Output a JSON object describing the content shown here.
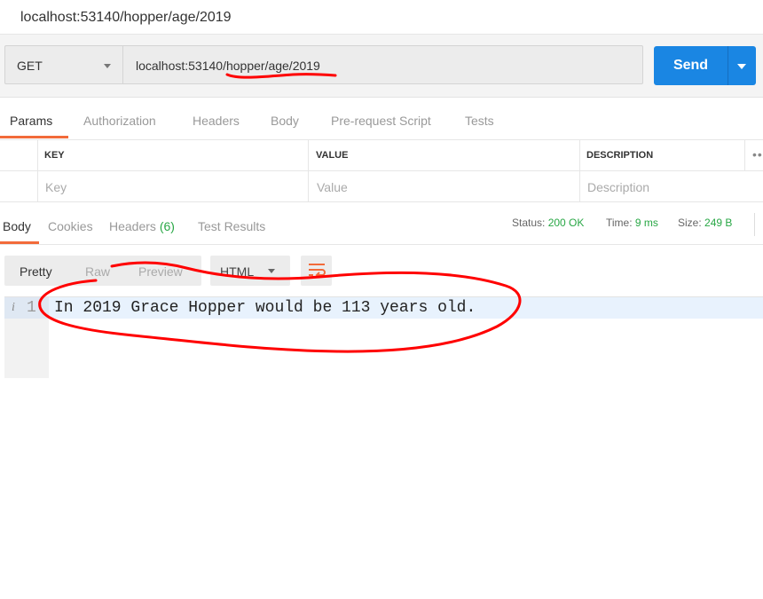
{
  "request_title": "localhost:53140/hopper/age/2019",
  "request": {
    "method": "GET",
    "url": "localhost:53140/hopper/age/2019",
    "send_label": "Send"
  },
  "request_tabs": [
    "Params",
    "Authorization",
    "Headers",
    "Body",
    "Pre-request Script",
    "Tests"
  ],
  "params_table": {
    "headers": [
      "KEY",
      "VALUE",
      "DESCRIPTION"
    ],
    "placeholders": [
      "Key",
      "Value",
      "Description"
    ],
    "more": "•••"
  },
  "response_tabs": {
    "body": "Body",
    "cookies": "Cookies",
    "headers": "Headers",
    "headers_count": "(6)",
    "test_results": "Test Results"
  },
  "response_status": {
    "status_label": "Status:",
    "status_value": "200 OK",
    "time_label": "Time:",
    "time_value": "9 ms",
    "size_label": "Size:",
    "size_value": "249 B"
  },
  "response_view": {
    "pretty": "Pretty",
    "raw": "Raw",
    "preview": "Preview",
    "format": "HTML"
  },
  "response_body": {
    "info_glyph": "i",
    "line_number": "1",
    "line_text": "In 2019 Grace Hopper would be 113 years old."
  },
  "colors": {
    "accent_orange": "#f26b3a",
    "send_blue": "#1a86e3",
    "status_green": "#28a745",
    "annotation_red": "#ff0000"
  },
  "icons": [
    "dropdown-caret-icon",
    "send-dropdown-caret-icon",
    "more-options-icon",
    "wrap-lines-icon",
    "info-icon"
  ]
}
